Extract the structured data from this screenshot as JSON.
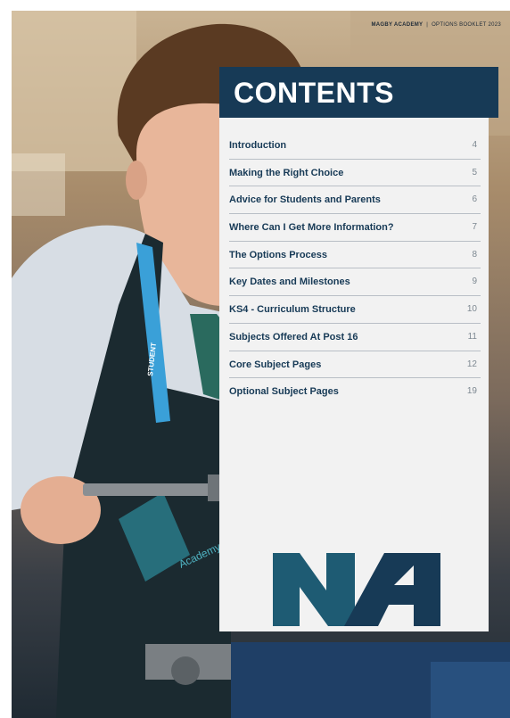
{
  "header": {
    "school": "MAGBY ACADEMY",
    "booklet": "OPTIONS BOOKLET 2023"
  },
  "title": "CONTENTS",
  "toc": [
    {
      "label": "Introduction",
      "page": "4"
    },
    {
      "label": "Making the Right Choice",
      "page": "5"
    },
    {
      "label": "Advice for Students and Parents",
      "page": "6"
    },
    {
      "label": "Where Can I Get More Information?",
      "page": "7"
    },
    {
      "label": "The Options Process",
      "page": "8"
    },
    {
      "label": "Key Dates and Milestones",
      "page": "9"
    },
    {
      "label": "KS4 - Curriculum Structure",
      "page": "10"
    },
    {
      "label": "Subjects Offered At Post 16",
      "page": "11"
    },
    {
      "label": "Core Subject Pages",
      "page": "12"
    },
    {
      "label": "Optional Subject Pages",
      "page": "19"
    }
  ],
  "photo": {
    "lanyard_text": "STUDENT",
    "apron_text": "Academy"
  },
  "colors": {
    "navy": "#173a56",
    "teal": "#1e5b73",
    "panel": "#f2f2f2"
  },
  "logo": {
    "name": "MA-logo-icon",
    "initials": "MA"
  }
}
